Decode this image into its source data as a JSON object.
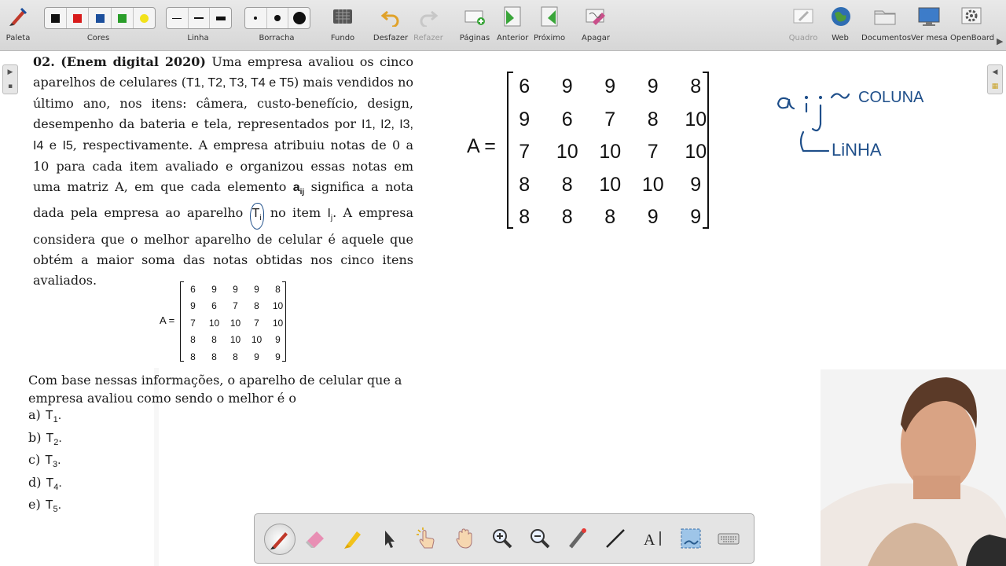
{
  "toolbar": {
    "paleta": "Paleta",
    "cores": "Cores",
    "linha": "Linha",
    "borracha": "Borracha",
    "fundo": "Fundo",
    "desfazer": "Desfazer",
    "refazer": "Refazer",
    "paginas": "Páginas",
    "anterior": "Anterior",
    "proximo": "Próximo",
    "apagar": "Apagar",
    "quadro": "Quadro",
    "web": "Web",
    "documentos": "Documentos",
    "ver_mesa": "Ver mesa",
    "openboard": "OpenBoard",
    "color_swatches": [
      "#111111",
      "#d81b1b",
      "#1c4f9c",
      "#2a9d2a",
      "#f2e21b"
    ]
  },
  "question": {
    "number": "02.",
    "source": "(Enem digital 2020)",
    "p1": "Uma empresa avaliou os cinco aparelhos de celulares (",
    "t1": "T",
    "p2": ") mais vendidos no último ano, nos itens: câmera, custo-benefício, design, desempenho da bateria e tela, representados por ",
    "p3": " e ",
    "p4": ", respectivamente. A empresa atribuiu notas de 0 a 10 para cada item avaliado e organizou essas notas em uma matriz A, em que cada elemento ",
    "aij": "a",
    "aij_sub": "ij",
    "p5": " significa a nota dada pela empresa ao aparelho ",
    "ti": "T",
    "ti_sub": "i",
    "p6": " no item ",
    "ij": "I",
    "ij_sub": "j",
    "p7": ". A empresa considera que o melhor aparelho de celular é aquele que obtém a maior soma das notas obtidas nos cinco itens avaliados.",
    "t_list": "T1, T2, T3, T4 e T5",
    "i_list": "I1, I2, I3, I4",
    "i5": "I5",
    "prompt": "Com base nessas informações, o aparelho de celular que a empresa avaliou como sendo o melhor é o",
    "options": [
      {
        "letter": "a)",
        "label": "T",
        "sub": "1",
        "end": "."
      },
      {
        "letter": "b)",
        "label": "T",
        "sub": "2",
        "end": "."
      },
      {
        "letter": "c)",
        "label": "T",
        "sub": "3",
        "end": "."
      },
      {
        "letter": "d)",
        "label": "T",
        "sub": "4",
        "end": "."
      },
      {
        "letter": "e)",
        "label": "T",
        "sub": "5",
        "end": "."
      }
    ]
  },
  "matrix": {
    "label": "A =",
    "rows": [
      [
        "6",
        "9",
        "9",
        "9",
        "8"
      ],
      [
        "9",
        "6",
        "7",
        "8",
        "10"
      ],
      [
        "7",
        "10",
        "10",
        "7",
        "10"
      ],
      [
        "8",
        "8",
        "10",
        "10",
        "9"
      ],
      [
        "8",
        "8",
        "8",
        "9",
        "9"
      ]
    ]
  },
  "handwriting": {
    "aij": "aij",
    "coluna": "COLUNA",
    "linha": "LiNHA"
  }
}
